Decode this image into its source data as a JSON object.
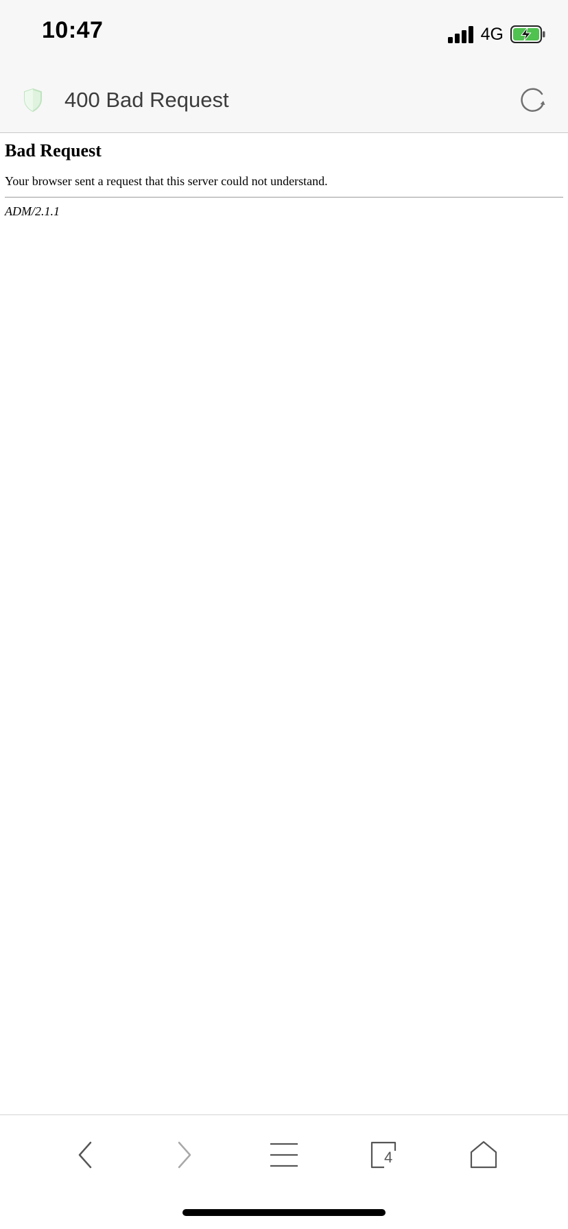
{
  "status_bar": {
    "time": "10:47",
    "network": "4G",
    "battery_charging": true,
    "battery_color": "#4fc24f"
  },
  "address_bar": {
    "title": "400 Bad Request",
    "shield_color": "#d7f0d7"
  },
  "page": {
    "heading": "Bad Request",
    "message": "Your browser sent a request that this server could not understand.",
    "server_signature": "ADM/2.1.1"
  },
  "toolbar": {
    "tabs_count": "4",
    "icons": [
      "back-icon",
      "forward-icon",
      "menu-icon",
      "tabs-icon",
      "home-icon"
    ]
  }
}
